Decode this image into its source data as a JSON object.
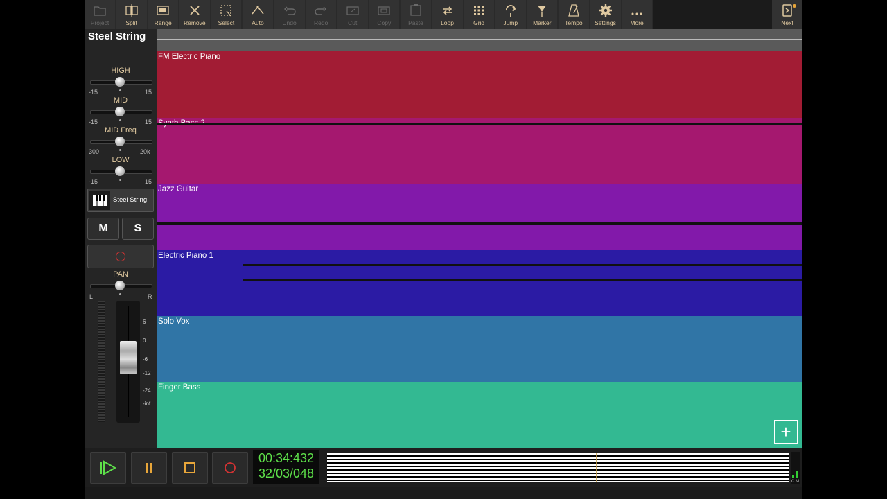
{
  "toolbar": {
    "buttons": [
      {
        "label": "Project",
        "icon": "folder-icon",
        "enabled": false
      },
      {
        "label": "Split",
        "icon": "split-icon",
        "enabled": true
      },
      {
        "label": "Range",
        "icon": "range-icon",
        "enabled": true
      },
      {
        "label": "Remove",
        "icon": "remove-icon",
        "enabled": true
      },
      {
        "label": "Select",
        "icon": "select-icon",
        "enabled": true
      },
      {
        "label": "Auto",
        "icon": "automation-icon",
        "enabled": true
      },
      {
        "label": "Undo",
        "icon": "undo-icon",
        "enabled": false
      },
      {
        "label": "Redo",
        "icon": "redo-icon",
        "enabled": false
      },
      {
        "label": "Cut",
        "icon": "cut-icon",
        "enabled": false
      },
      {
        "label": "Copy",
        "icon": "copy-icon",
        "enabled": false
      },
      {
        "label": "Paste",
        "icon": "paste-icon",
        "enabled": false
      },
      {
        "label": "Loop",
        "icon": "loop-icon",
        "enabled": true
      },
      {
        "label": "Grid",
        "icon": "grid-icon",
        "enabled": true
      },
      {
        "label": "Jump",
        "icon": "jump-icon",
        "enabled": true
      },
      {
        "label": "Marker",
        "icon": "marker-icon",
        "enabled": true
      },
      {
        "label": "Tempo",
        "icon": "metronome-icon",
        "enabled": true
      },
      {
        "label": "Settings",
        "icon": "gear-icon",
        "enabled": true
      },
      {
        "label": "More",
        "icon": "more-icon",
        "enabled": true
      }
    ],
    "next_label": "Next"
  },
  "strip": {
    "title": "Steel String",
    "eq": [
      {
        "label": "HIGH",
        "min": "-15",
        "max": "15",
        "value": 0
      },
      {
        "label": "MID",
        "min": "-15",
        "max": "15",
        "value": 0
      },
      {
        "label": "MID Freq",
        "min": "300",
        "max": "20k",
        "value": 0.5
      },
      {
        "label": "LOW",
        "min": "-15",
        "max": "15",
        "value": 0
      }
    ],
    "instrument_name": "Steel String",
    "mute_label": "M",
    "solo_label": "S",
    "pan": {
      "label": "PAN",
      "left": "L",
      "right": "R",
      "value": 0
    },
    "fader_scale": [
      "6",
      "0",
      "-6",
      "-12",
      "-24",
      "-inf"
    ]
  },
  "tracks": [
    {
      "name": "FM Electric Piano",
      "color": "#a21c34"
    },
    {
      "name": "Synth Bass 2",
      "color": "#a5186f"
    },
    {
      "name": "Jazz Guitar",
      "color": "#8219aa"
    },
    {
      "name": "Electric Piano 1",
      "color": "#2b1ba4"
    },
    {
      "name": "Solo Vox",
      "color": "#3075a6"
    },
    {
      "name": "Finger Bass",
      "color": "#33b992"
    }
  ],
  "add_track_label": "+",
  "transport": {
    "time": "00:34:432",
    "bars": "32/03/048",
    "meter_labels": [
      "C",
      "M"
    ]
  },
  "colors": {
    "accent": "#e0c9a0",
    "counter": "#5ee04a",
    "record": "#d33333"
  }
}
